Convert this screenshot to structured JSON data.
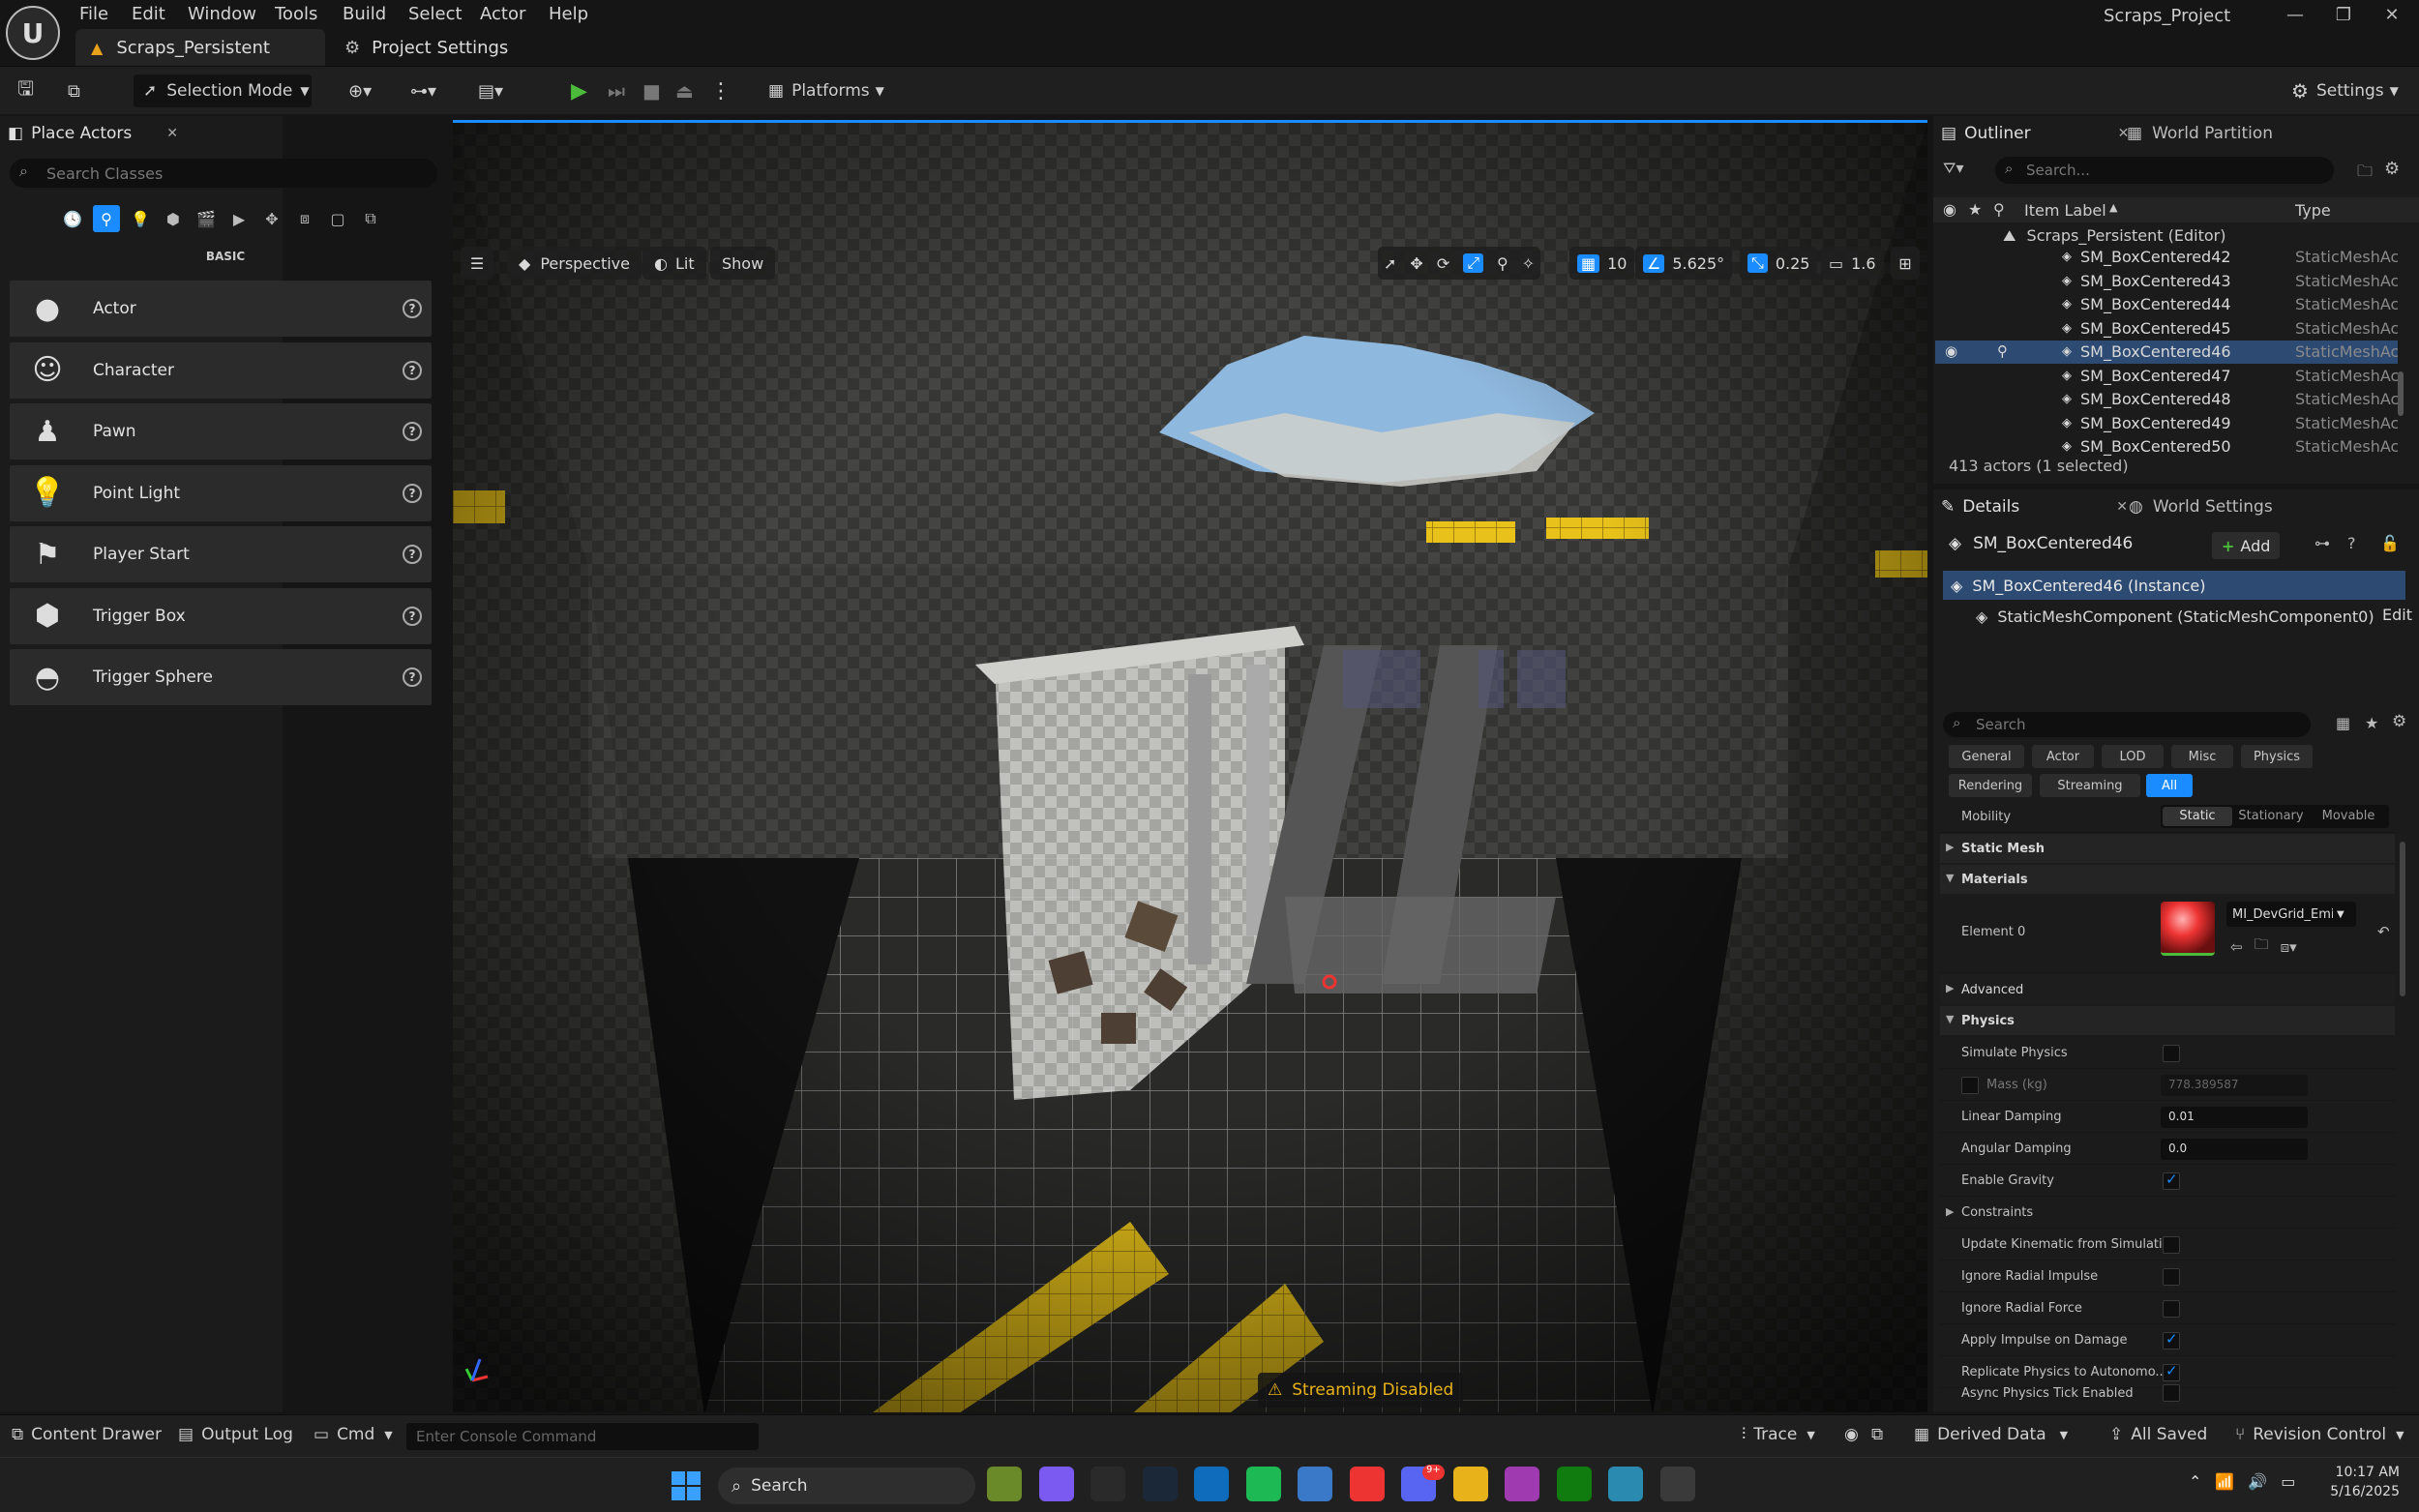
{
  "app": {
    "project_name": "Scraps_Project"
  },
  "menu": [
    "File",
    "Edit",
    "Window",
    "Tools",
    "Build",
    "Select",
    "Actor",
    "Help"
  ],
  "tabs": [
    {
      "label": "Scraps_Persistent"
    },
    {
      "label": "Project Settings"
    }
  ],
  "toolbar": {
    "selection_mode": "Selection Mode",
    "platforms": "Platforms",
    "settings": "Settings"
  },
  "place_actors": {
    "tab_label": "Place Actors",
    "search_placeholder": "Search Classes",
    "category": "BASIC",
    "items": [
      {
        "label": "Actor",
        "icon": "sphere-icon"
      },
      {
        "label": "Character",
        "icon": "character-icon"
      },
      {
        "label": "Pawn",
        "icon": "pawn-icon"
      },
      {
        "label": "Point Light",
        "icon": "point-light-icon"
      },
      {
        "label": "Player Start",
        "icon": "player-start-icon"
      },
      {
        "label": "Trigger Box",
        "icon": "trigger-box-icon"
      },
      {
        "label": "Trigger Sphere",
        "icon": "trigger-sphere-icon"
      }
    ]
  },
  "viewport": {
    "perspective": "Perspective",
    "lit": "Lit",
    "show": "Show",
    "grid_snap": "10",
    "angle_snap": "5.625°",
    "scale_snap": "0.25",
    "camera_speed": "1.6",
    "streaming_warning": "Streaming Disabled"
  },
  "outliner": {
    "tab_label": "Outliner",
    "tab2_label": "World Partition",
    "search_placeholder": "Search...",
    "col_label": "Item Label",
    "col_type": "Type",
    "root": "Scraps_Persistent (Editor)",
    "rows": [
      {
        "name": "SM_BoxCentered42",
        "type": "StaticMeshActor"
      },
      {
        "name": "SM_BoxCentered43",
        "type": "StaticMeshActor"
      },
      {
        "name": "SM_BoxCentered44",
        "type": "StaticMeshActor"
      },
      {
        "name": "SM_BoxCentered45",
        "type": "StaticMeshActor"
      },
      {
        "name": "SM_BoxCentered46",
        "type": "StaticMeshActor"
      },
      {
        "name": "SM_BoxCentered47",
        "type": "StaticMeshActor"
      },
      {
        "name": "SM_BoxCentered48",
        "type": "StaticMeshActor"
      },
      {
        "name": "SM_BoxCentered49",
        "type": "StaticMeshActor"
      },
      {
        "name": "SM_BoxCentered50",
        "type": "StaticMeshActor"
      }
    ],
    "footer": "413 actors (1 selected)"
  },
  "details": {
    "tab_label": "Details",
    "tab2_label": "World Settings",
    "actor_name": "SM_BoxCentered46",
    "add_label": "Add",
    "instance": "SM_BoxCentered46 (Instance)",
    "component": "StaticMeshComponent (StaticMeshComponent0)",
    "edit": "Edit",
    "search_placeholder": "Search",
    "filters": [
      "General",
      "Actor",
      "LOD",
      "Misc",
      "Physics",
      "Rendering",
      "Streaming",
      "All"
    ],
    "mobility_label": "Mobility",
    "mobility": [
      "Static",
      "Stationary",
      "Movable"
    ],
    "section_static_mesh": "Static Mesh",
    "section_materials": "Materials",
    "element0_label": "Element 0",
    "material_name": "MI_DevGrid_Emissive",
    "section_advanced": "Advanced",
    "section_physics": "Physics",
    "simulate_physics": "Simulate Physics",
    "mass_label": "Mass (kg)",
    "mass_value": "778.389587",
    "linear_damping_label": "Linear Damping",
    "linear_damping": "0.01",
    "angular_damping_label": "Angular Damping",
    "angular_damping": "0.0",
    "enable_gravity": "Enable Gravity",
    "constraints": "Constraints",
    "update_kinematic": "Update Kinematic from Simulati...",
    "ignore_radial_impulse": "Ignore Radial Impulse",
    "ignore_radial_force": "Ignore Radial Force",
    "apply_impulse": "Apply Impulse on Damage",
    "replicate_physics": "Replicate Physics to Autonomo...",
    "async_physics": "Async Physics Tick Enabled"
  },
  "statusbar": {
    "content_drawer": "Content Drawer",
    "output_log": "Output Log",
    "cmd": "Cmd",
    "console_placeholder": "Enter Console Command",
    "trace": "Trace",
    "derived_data": "Derived Data",
    "all_saved": "All Saved",
    "revision_control": "Revision Control"
  },
  "taskbar": {
    "search": "Search",
    "time": "10:17 AM",
    "date": "5/16/2025",
    "discord_badge": "9+"
  },
  "colors": {
    "accent": "#1a8cff",
    "selection": "#2d4a73",
    "gold": "#e8c21a"
  }
}
